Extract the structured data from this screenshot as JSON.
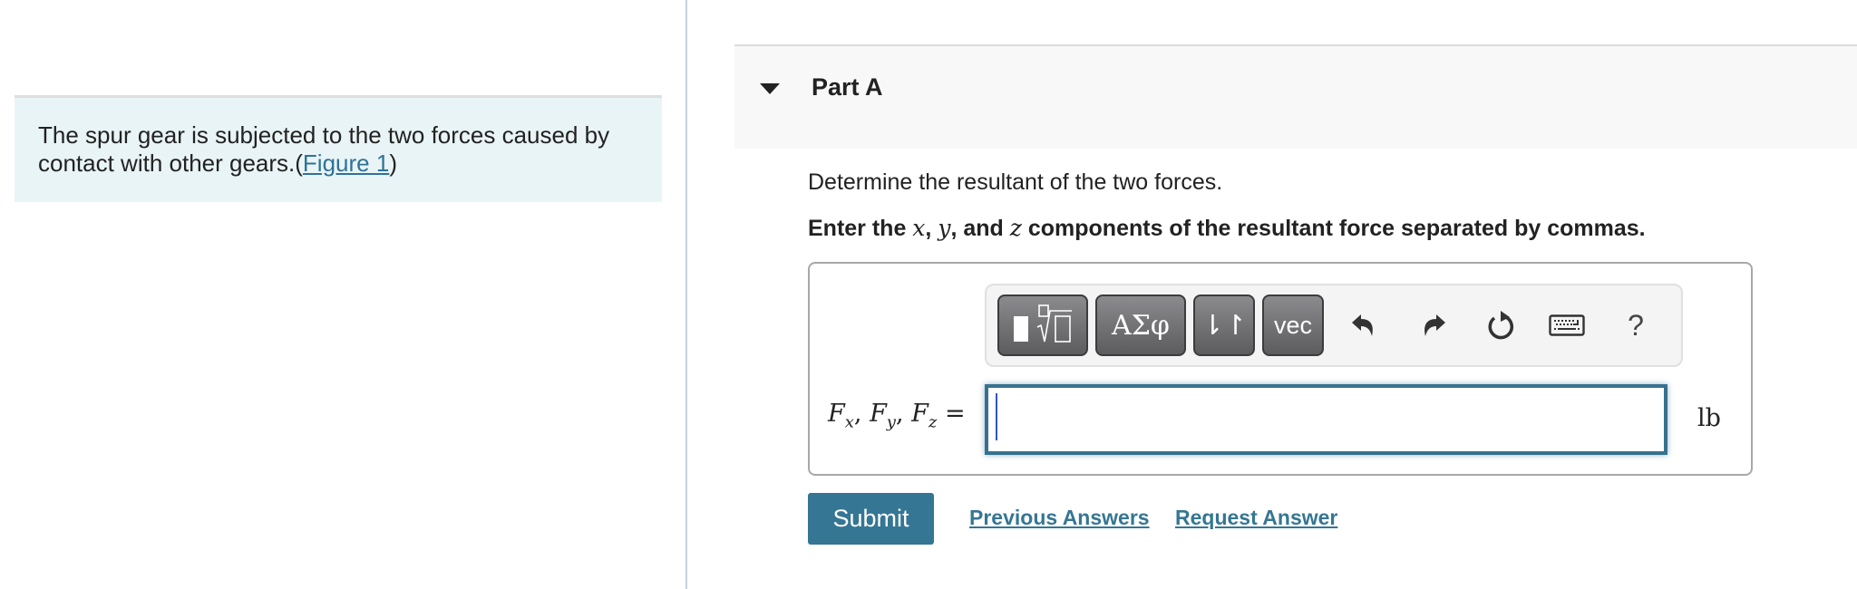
{
  "intro": {
    "text": "The spur gear is subjected to the two forces caused by contact with other gears.(",
    "figure_link": "Figure 1",
    "text_end": ")"
  },
  "part": {
    "title": "Part A",
    "expanded": true
  },
  "question": {
    "prompt": "Determine the resultant of the two forces.",
    "instruction_prefix": "Enter the ",
    "var_x": "x",
    "sep1": ", ",
    "var_y": "y",
    "sep2": ", and ",
    "var_z": "z",
    "instruction_suffix": " components of the resultant force separated by commas."
  },
  "toolbar": {
    "templates_icon": "templates-root-icon",
    "greek_label": "ΑΣφ",
    "updown_label": "⇂↾",
    "vec_label": "vec",
    "undo_icon": "undo-icon",
    "redo_icon": "redo-icon",
    "reset_icon": "reset-icon",
    "keyboard_icon": "keyboard-icon",
    "help_label": "?"
  },
  "answer": {
    "label_F": "F",
    "sub_x": "x",
    "sub_y": "y",
    "sub_z": "z",
    "comma": ", ",
    "equals": " =",
    "value": "",
    "unit": "lb"
  },
  "actions": {
    "submit_label": "Submit",
    "previous_answers_label": "Previous Answers",
    "request_answer_label": "Request Answer"
  },
  "colors": {
    "accent": "#357694",
    "intro_bg": "#e9f4f6",
    "header_bg": "#f8f8f8"
  }
}
